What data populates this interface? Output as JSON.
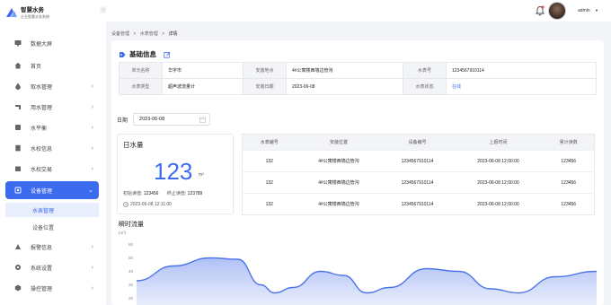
{
  "app": {
    "name": "智慧水务",
    "subtitle": "企业智慧水务系统"
  },
  "sidebar": {
    "items": [
      {
        "label": "数据大屏",
        "icon": "monitor-icon",
        "arrow": false
      },
      {
        "label": "首页",
        "icon": "home-icon",
        "arrow": false
      },
      {
        "label": "取水管理",
        "icon": "water-drop-icon",
        "arrow": true
      },
      {
        "label": "用水管理",
        "icon": "faucet-icon",
        "arrow": true
      },
      {
        "label": "水平衡",
        "icon": "balance-icon",
        "arrow": true
      },
      {
        "label": "水权信息",
        "icon": "document-icon",
        "arrow": true
      },
      {
        "label": "水权交易",
        "icon": "exchange-icon",
        "arrow": true
      },
      {
        "label": "设备管理",
        "icon": "device-icon",
        "arrow": true,
        "active": true
      },
      {
        "label": "报警信息",
        "icon": "alarm-icon",
        "arrow": true
      },
      {
        "label": "系统设置",
        "icon": "settings-icon",
        "arrow": true
      },
      {
        "label": "操控管理",
        "icon": "control-icon",
        "arrow": true
      }
    ],
    "sub_items": [
      {
        "label": "水表管理",
        "active": true
      },
      {
        "label": "设备位置",
        "active": false
      }
    ]
  },
  "topbar": {
    "username": "admin",
    "dropdown_icon": "caret-down-icon"
  },
  "breadcrumb": {
    "items": [
      "设备管理",
      "水表管理",
      "详情"
    ],
    "separator": ">"
  },
  "basic_info": {
    "title": "基础信息",
    "rows": [
      [
        "单元名称",
        "华宇市",
        "安装地点",
        "4#公寓楼西墙边管沟",
        "水表号",
        "1234567910114"
      ],
      [
        "水表类型",
        "超声波流量计",
        "安装日期",
        "2023-06-08",
        "水表状态",
        "在线"
      ]
    ]
  },
  "date_filter": {
    "label": "日期",
    "value": "2023-06-08"
  },
  "daily": {
    "title": "日水量",
    "value": "123",
    "unit": "m³",
    "start_label": "初始读值:",
    "start_value": "123456",
    "end_label": "终止读值:",
    "end_value": "123789",
    "time": "2023-06-08 12:11:00"
  },
  "meter_table": {
    "headers": [
      "水表编号",
      "安装位置",
      "设备编号",
      "上报时间",
      "累计读数"
    ],
    "rows": [
      [
        "132",
        "4#公寓楼西墙边管沟",
        "1234567910114",
        "2023-06-08 12:00:00",
        "123456"
      ],
      [
        "132",
        "4#公寓楼西墙边管沟",
        "1234567910114",
        "2023-06-08 12:00:00",
        "123456"
      ],
      [
        "132",
        "4#公寓楼西墙边管沟",
        "1234567910114",
        "2023-06-08 12:00:00",
        "123456"
      ]
    ]
  },
  "flow": {
    "title": "瞬时流量",
    "unit": "(m³)"
  },
  "chart_data": {
    "type": "area",
    "title": "瞬时流量",
    "ylabel": "(m³)",
    "yticks": [
      60,
      50,
      40,
      30,
      20
    ],
    "ylim": [
      15,
      65
    ],
    "points": [
      [
        0,
        33
      ],
      [
        8,
        44
      ],
      [
        16,
        50
      ],
      [
        22,
        49
      ],
      [
        27,
        30
      ],
      [
        30,
        24
      ],
      [
        34,
        28
      ],
      [
        40,
        40
      ],
      [
        45,
        37
      ],
      [
        50,
        24
      ],
      [
        55,
        28
      ],
      [
        63,
        42
      ],
      [
        70,
        40
      ],
      [
        77,
        27
      ],
      [
        83,
        24
      ],
      [
        91,
        36
      ],
      [
        100,
        40
      ]
    ],
    "color": "#4d74e8"
  },
  "colors": {
    "accent": "#3d6bf0"
  }
}
